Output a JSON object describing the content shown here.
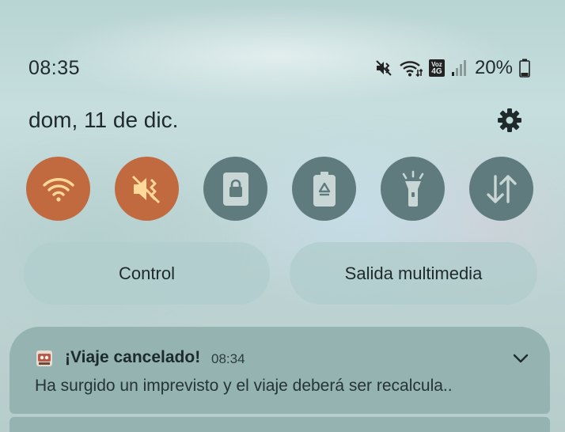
{
  "status_bar": {
    "time": "08:35",
    "network_badge_top": "Voz",
    "network_badge_bottom": "4G",
    "battery_percent": "20%",
    "icons": [
      "mute-icon",
      "wifi-icon",
      "volte-4g-icon",
      "signal-icon",
      "battery-icon"
    ]
  },
  "header": {
    "date": "dom, 11 de dic.",
    "settings_icon": "gear-icon"
  },
  "quick_toggles": [
    {
      "name": "wifi",
      "icon": "wifi-icon",
      "active": true
    },
    {
      "name": "sound",
      "icon": "mute-icon",
      "active": true
    },
    {
      "name": "screen-lock",
      "icon": "lock-icon",
      "active": false
    },
    {
      "name": "power-saving",
      "icon": "battery-recycle-icon",
      "active": false
    },
    {
      "name": "flashlight",
      "icon": "flashlight-icon",
      "active": false
    },
    {
      "name": "mobile-data",
      "icon": "data-arrows-icon",
      "active": false
    }
  ],
  "buttons": {
    "control_label": "Control",
    "media_output_label": "Salida multimedia"
  },
  "notification": {
    "title": "¡Viaje cancelado!",
    "time": "08:34",
    "body": "Ha surgido un imprevisto y el viaje deberá ser recalcula.."
  },
  "colors": {
    "toggle_on": "#c26a3f",
    "toggle_on_icon": "#ffd89a",
    "toggle_off": "#5f7b7d",
    "notification_bg": "#94b3b1"
  }
}
